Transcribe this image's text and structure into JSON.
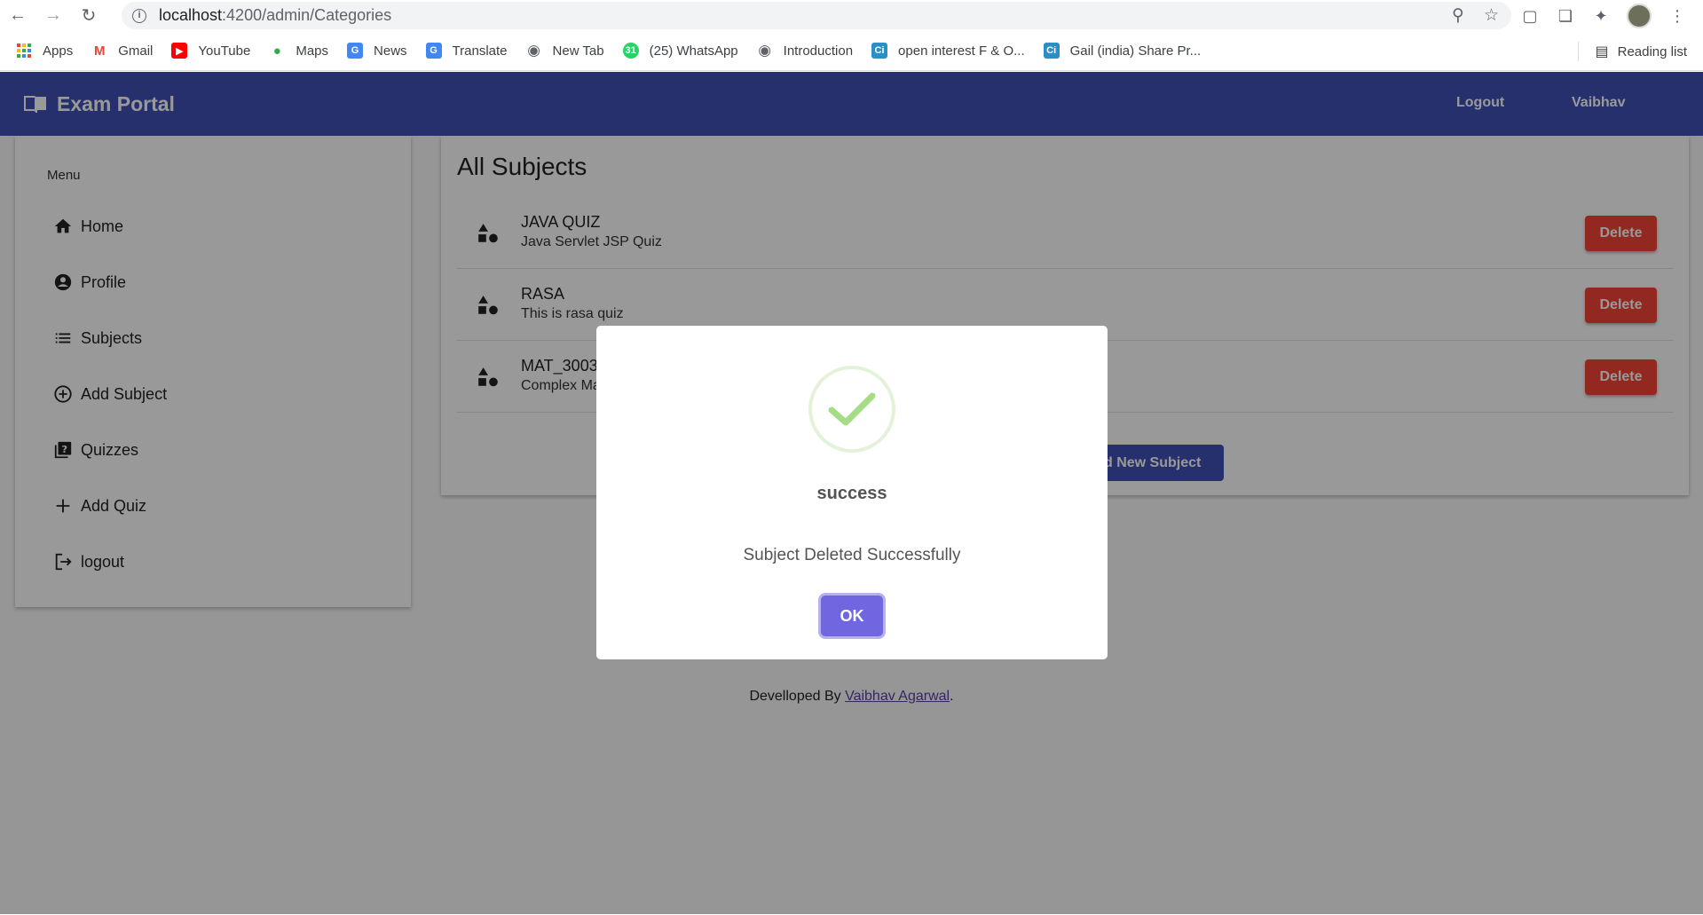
{
  "browser": {
    "url_host": "localhost",
    "url_path": ":4200/admin/Categories",
    "bookmarks": [
      {
        "label": "Apps",
        "icon": "apps-grid-icon",
        "color": "#ea4335"
      },
      {
        "label": "Gmail",
        "icon": "gmail-icon",
        "color": "#ea4335"
      },
      {
        "label": "YouTube",
        "icon": "youtube-icon",
        "color": "#ff0000"
      },
      {
        "label": "Maps",
        "icon": "maps-pin-icon",
        "color": "#34a853"
      },
      {
        "label": "News",
        "icon": "news-icon",
        "color": "#4285f4"
      },
      {
        "label": "Translate",
        "icon": "translate-icon",
        "color": "#4285f4"
      },
      {
        "label": "New Tab",
        "icon": "globe-icon",
        "color": "#5f6368"
      },
      {
        "label": "(25) WhatsApp",
        "icon": "whatsapp-icon",
        "color": "#25d366"
      },
      {
        "label": "Introduction",
        "icon": "globe-icon",
        "color": "#5f6368"
      },
      {
        "label": "open interest F & O...",
        "icon": "ci-icon",
        "color": "#2b8fc6"
      },
      {
        "label": "Gail (india) Share Pr...",
        "icon": "ci-icon",
        "color": "#2b8fc6"
      }
    ],
    "reading_list": "Reading list"
  },
  "app": {
    "brand": "Exam Portal",
    "logout": "Logout",
    "user": "Vaibhav",
    "primary_color": "#3f51b5"
  },
  "sidebar": {
    "title": "Menu",
    "items": [
      {
        "label": "Home",
        "icon": "home-icon"
      },
      {
        "label": "Profile",
        "icon": "account-circle-icon"
      },
      {
        "label": "Subjects",
        "icon": "list-icon"
      },
      {
        "label": "Add Subject",
        "icon": "add-circle-icon"
      },
      {
        "label": "Quizzes",
        "icon": "quiz-icon"
      },
      {
        "label": "Add Quiz",
        "icon": "plus-icon"
      },
      {
        "label": "logout",
        "icon": "logout-icon"
      }
    ]
  },
  "main": {
    "title": "All Subjects",
    "subjects": [
      {
        "title": "JAVA QUIZ",
        "description": "Java Servlet JSP Quiz",
        "action": "Delete"
      },
      {
        "title": "RASA",
        "description": "This is rasa quiz",
        "action": "Delete"
      },
      {
        "title": "MAT_3003",
        "description": "Complex Maths",
        "action": "Delete"
      }
    ],
    "add_button": "Add New Subject"
  },
  "footer": {
    "prefix": "Develloped By ",
    "author": "Vaibhav Agarwal",
    "suffix": "."
  },
  "dialog": {
    "icon": "success-check-icon",
    "title": "success",
    "text": "Subject Deleted Successfully",
    "button": "OK",
    "check_color": "#a5dc86"
  }
}
